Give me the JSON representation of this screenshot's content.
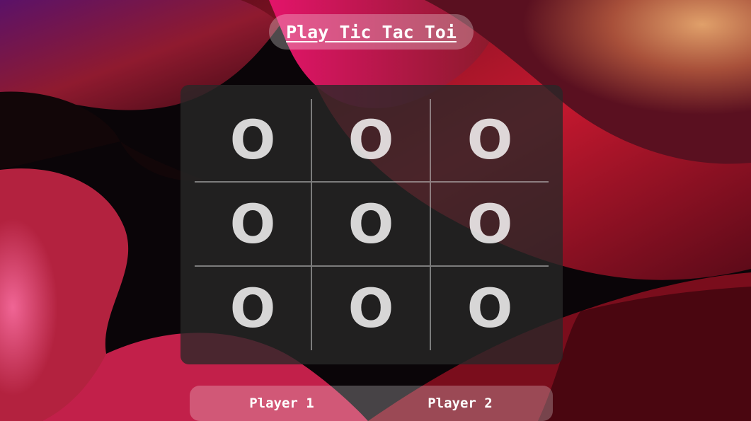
{
  "header": {
    "title": "Play Tic Tac Toi"
  },
  "board": {
    "cells": [
      "O",
      "O",
      "O",
      "O",
      "O",
      "O",
      "O",
      "O",
      "O"
    ]
  },
  "players": {
    "player1": "Player 1",
    "player2": "Player 2"
  },
  "colors": {
    "wallpaper_dark": "#0a0508",
    "wallpaper_red": "#b3122a",
    "wallpaper_pink": "#e8457a",
    "wallpaper_orange": "#d9875a",
    "panel": "#282828",
    "text": "#ffffff"
  }
}
